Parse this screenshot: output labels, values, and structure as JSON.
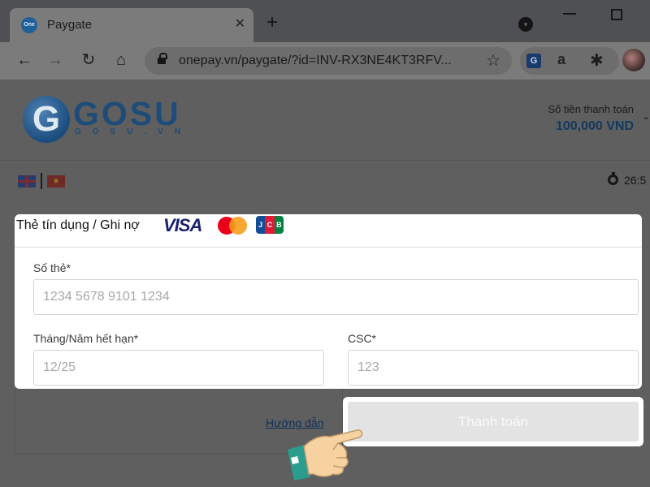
{
  "browser": {
    "tab_favicon": "One",
    "tab_title": "Paygate",
    "tab_close_icon": "✕",
    "new_tab_icon": "+",
    "url": "onepay.vn/paygate/?id=INV-RX3NE4KT3RFV...",
    "icons": [
      "back-arrow-icon",
      "forward-arrow-icon",
      "reload-icon",
      "home-icon",
      "lock-icon",
      "star-icon",
      "translate-icon",
      "extension-a-icon",
      "puzzle-icon",
      "avatar"
    ]
  },
  "header": {
    "logo_text": "GOSU",
    "logo_sub": "GOSU.VN",
    "amount_label": "Số tiền thanh toán",
    "amount_value": "100,000 VND"
  },
  "timer": {
    "text": "26:5"
  },
  "card_form": {
    "title": "Thẻ tín dụng / Ghi nợ",
    "brands": [
      "VISA",
      "Mastercard",
      "JCB"
    ],
    "card_number": {
      "label": "Số thẻ*",
      "placeholder": "1234 5678 9101 1234",
      "value": ""
    },
    "expiry": {
      "label": "Tháng/Năm hết hạn*",
      "placeholder": "12/25",
      "value": ""
    },
    "csc": {
      "label": "CSC*",
      "placeholder": "123",
      "value": ""
    }
  },
  "actions": {
    "guide_link": "Hướng dẫn",
    "pay_button": "Thanh toán"
  },
  "colors": {
    "overlay": "#5f5f5f",
    "brand_blue": "#1d4c78",
    "card_bg": "#ffffff",
    "button_disabled": "#e3e3e3"
  }
}
